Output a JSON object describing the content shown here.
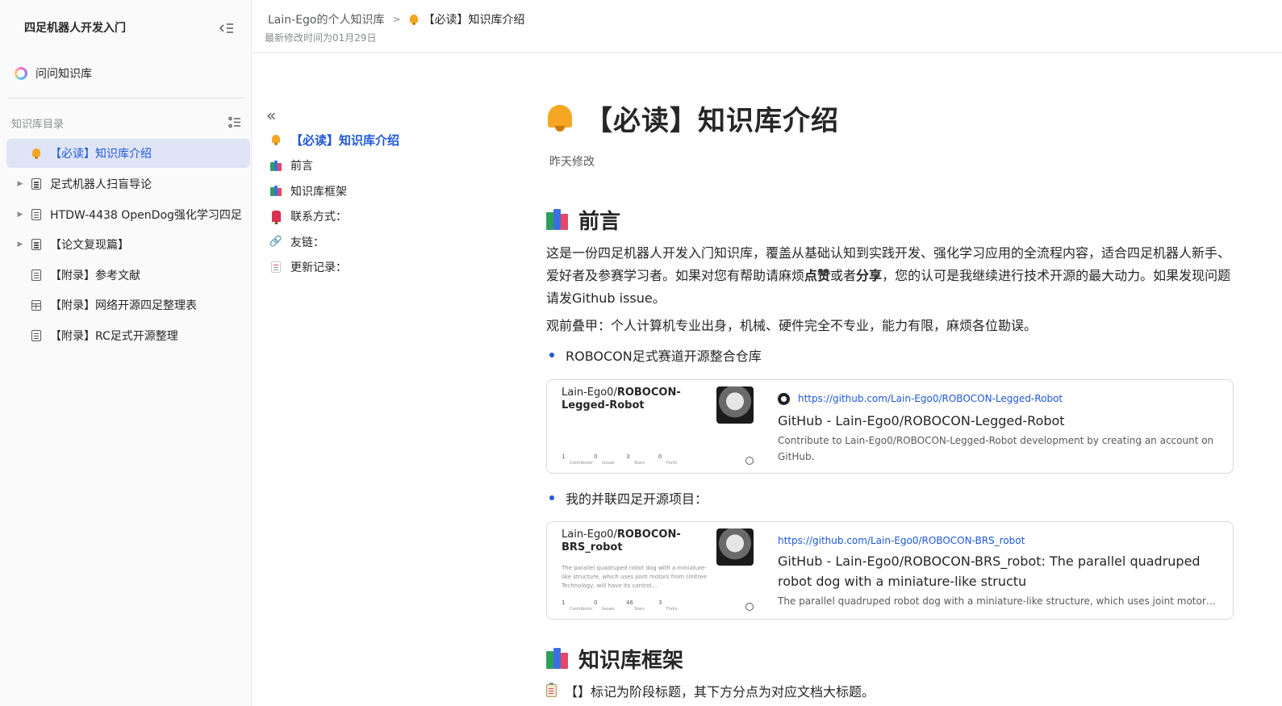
{
  "sidebar": {
    "title": "四足机器人开发入门",
    "ask_label": "问问知识库",
    "directory_label": "知识库目录",
    "items": [
      {
        "label": "【必读】知识库介绍",
        "icon": "bell-icon",
        "caret": false,
        "active": true
      },
      {
        "label": "足式机器人扫盲导论",
        "icon": "document-icon",
        "caret": true,
        "active": false
      },
      {
        "label": "HTDW-4438 OpenDog强化学习四足",
        "icon": "document-icon",
        "caret": true,
        "active": false
      },
      {
        "label": "【论文复现篇】",
        "icon": "document-icon",
        "caret": true,
        "active": false
      },
      {
        "label": "【附录】参考文献",
        "icon": "document-icon",
        "caret": false,
        "active": false
      },
      {
        "label": "【附录】网络开源四足整理表",
        "icon": "table-icon",
        "caret": false,
        "active": false
      },
      {
        "label": "【附录】RC足式开源整理",
        "icon": "document-icon",
        "caret": false,
        "active": false
      }
    ]
  },
  "header": {
    "breadcrumb_root": "Lain-Ego的个人知识库",
    "breadcrumb_current": "【必读】知识库介绍",
    "last_modified": "最新修改时间为01月29日"
  },
  "toc": {
    "items": [
      {
        "label": "【必读】知识库介绍",
        "icon": "bell-icon",
        "active": true
      },
      {
        "label": "前言",
        "icon": "books-icon",
        "active": false
      },
      {
        "label": "知识库框架",
        "icon": "books-icon",
        "active": false
      },
      {
        "label": "联系方式：",
        "icon": "mailbox-icon",
        "active": false
      },
      {
        "label": "友链：",
        "icon": "link-icon",
        "active": false
      },
      {
        "label": "更新记录：",
        "icon": "memo-icon",
        "active": false
      }
    ]
  },
  "doc": {
    "title": "【必读】知识库介绍",
    "meta": "昨天修改",
    "section1_heading": "前言",
    "intro_part1": "这是一份四足机器人开发入门知识库，覆盖从基础认知到实践开发、强化学习应用的全流程内容，适合四足机器人新手、爱好者及参赛学习者。如果对您有帮助请麻烦",
    "intro_bold1": "点赞",
    "intro_part2": "或者",
    "intro_bold2": "分享",
    "intro_part3": "，您的认可是我继续进行技术开源的最大动力。如果发现问题请发Github issue。",
    "disclaimer": "观前叠甲：个人计算机专业出身，机械、硬件完全不专业，能力有限，麻烦各位勘误。",
    "bullet1": "ROBOCON足式赛道开源整合仓库",
    "bullet2": "我的并联四足开源项目：",
    "section2_heading": "知识库框架",
    "framework_note": "【】标记为阶段标题，其下方分点为对应文档大标题。"
  },
  "cards": [
    {
      "preview_owner": "Lain-Ego0/",
      "preview_repo": "ROBOCON-Legged-Robot",
      "preview_desc": "",
      "stats": [
        {
          "value": "1",
          "label": "Contributor"
        },
        {
          "value": "0",
          "label": "Issues"
        },
        {
          "value": "3",
          "label": "Stars"
        },
        {
          "value": "0",
          "label": "Forks"
        }
      ],
      "url": "https://github.com/Lain-Ego0/ROBOCON-Legged-Robot",
      "title": "GitHub - Lain-Ego0/ROBOCON-Legged-Robot",
      "desc": "Contribute to Lain-Ego0/ROBOCON-Legged-Robot development by creating an account on GitHub."
    },
    {
      "preview_owner": "Lain-Ego0/",
      "preview_repo": "ROBOCON-BRS_robot",
      "preview_desc": "The parallel quadruped robot dog with a miniature-like structure, which uses joint motors from Unitree Technology, will have its control...",
      "stats": [
        {
          "value": "1",
          "label": "Contributor"
        },
        {
          "value": "0",
          "label": "Issues"
        },
        {
          "value": "46",
          "label": "Stars"
        },
        {
          "value": "3",
          "label": "Forks"
        }
      ],
      "url": "https://github.com/Lain-Ego0/ROBOCON-BRS_robot",
      "title": "GitHub - Lain-Ego0/ROBOCON-BRS_robot: The parallel quadruped robot dog with a miniature-like structu",
      "desc": "The parallel quadruped robot dog with a miniature-like structure, which uses joint motors..."
    }
  ],
  "colors": {
    "accent": "#1d58d8",
    "active_bg": "#dfe4f7",
    "sidebar_bg": "#fafafa"
  }
}
